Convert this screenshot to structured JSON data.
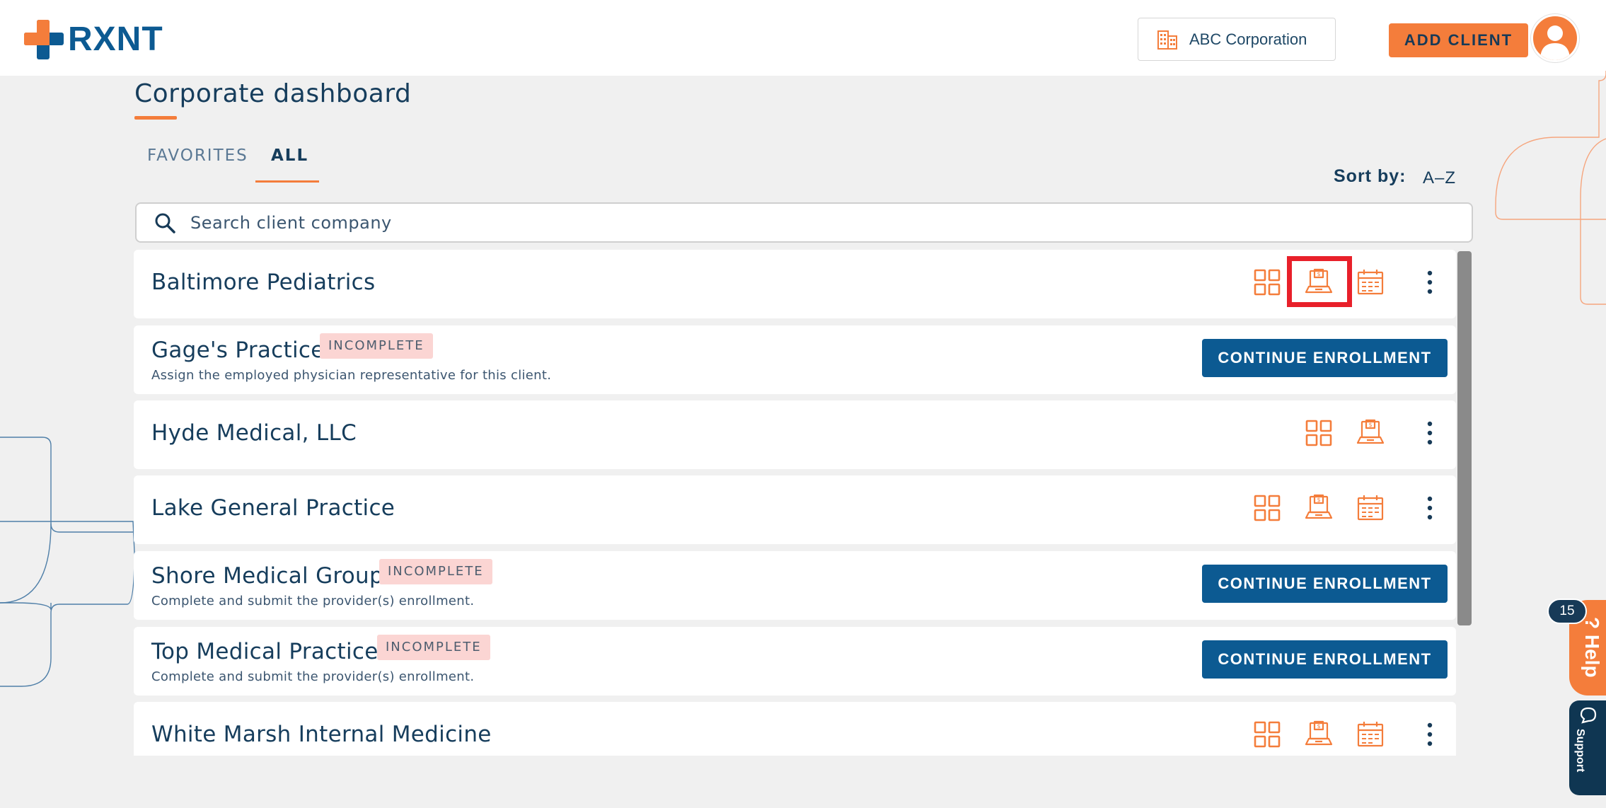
{
  "app": {
    "brand": "RXNT"
  },
  "header": {
    "organization": "ABC Corporation",
    "add_client_label": "ADD CLIENT"
  },
  "page": {
    "title": "Corporate dashboard",
    "tabs": [
      {
        "label": "FAVORITES",
        "active": false
      },
      {
        "label": "ALL",
        "active": true
      }
    ],
    "sort": {
      "label": "Sort by:",
      "value": "A–Z"
    },
    "search": {
      "placeholder": "Search client company",
      "value": ""
    }
  },
  "clients": [
    {
      "name": "Baltimore Pediatrics",
      "status": "complete",
      "actions": [
        "grid-icon",
        "billing-laptop-icon",
        "calendar-icon"
      ]
    },
    {
      "name": "Gage's Practice",
      "status": "INCOMPLETE",
      "message": "Assign the employed physician representative for this client.",
      "button": "CONTINUE ENROLLMENT"
    },
    {
      "name": "Hyde Medical, LLC",
      "status": "complete",
      "actions": [
        "grid-icon",
        "billing-laptop-icon"
      ]
    },
    {
      "name": "Lake General Practice",
      "status": "complete",
      "actions": [
        "grid-icon",
        "billing-laptop-icon",
        "calendar-icon"
      ]
    },
    {
      "name": "Shore Medical Group",
      "status": "INCOMPLETE",
      "message": "Complete and submit the provider(s) enrollment.",
      "button": "CONTINUE ENROLLMENT"
    },
    {
      "name": "Top Medical Practice",
      "status": "INCOMPLETE",
      "message": "Complete and submit the provider(s) enrollment.",
      "button": "CONTINUE ENROLLMENT"
    },
    {
      "name": "White Marsh Internal Medicine",
      "status": "complete",
      "actions": [
        "grid-icon",
        "billing-laptop-icon",
        "calendar-icon"
      ]
    }
  ],
  "help": {
    "label": "? Help",
    "count": "15"
  },
  "support": {
    "label": "Support"
  },
  "colors": {
    "brand_blue": "#0c5a92",
    "accent_orange": "#f47d3b",
    "badge_bg": "#fbd5d3",
    "highlight_red": "#e8202a"
  }
}
